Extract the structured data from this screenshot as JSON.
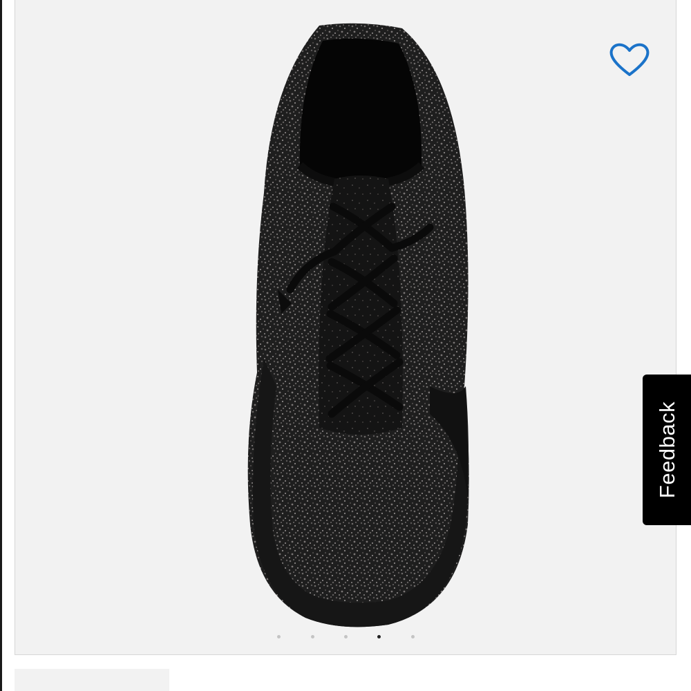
{
  "gallery": {
    "image_alt": "",
    "slide_count": 5,
    "active_slide_index": 3
  },
  "favorite": {
    "icon": "heart-outline-icon",
    "color": "#1b73c9"
  },
  "feedback": {
    "label": "Feedback",
    "background": "#000000"
  }
}
